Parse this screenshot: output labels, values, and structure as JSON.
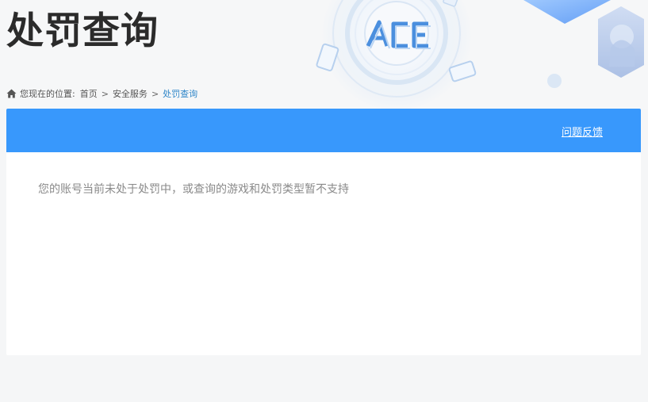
{
  "page": {
    "title": "处罚查询"
  },
  "breadcrumb": {
    "prefix": "您现在的位置:",
    "items": [
      "首页",
      "安全服务",
      "处罚查询"
    ],
    "separator": ">"
  },
  "panel": {
    "feedback_label": "问题反馈",
    "message": "您的账号当前未处于处罚中，或查询的游戏和处罚类型暂不支持"
  },
  "header_art": {
    "logo_text": "ACE"
  },
  "colors": {
    "bar_blue": "#3898fc",
    "breadcrumb_current": "#2f86c8",
    "title_text": "#2b2b2b",
    "message_text": "#8a8a8a",
    "page_bg": "#f5f6f7"
  },
  "icons": {
    "breadcrumb_home": "home-icon"
  }
}
